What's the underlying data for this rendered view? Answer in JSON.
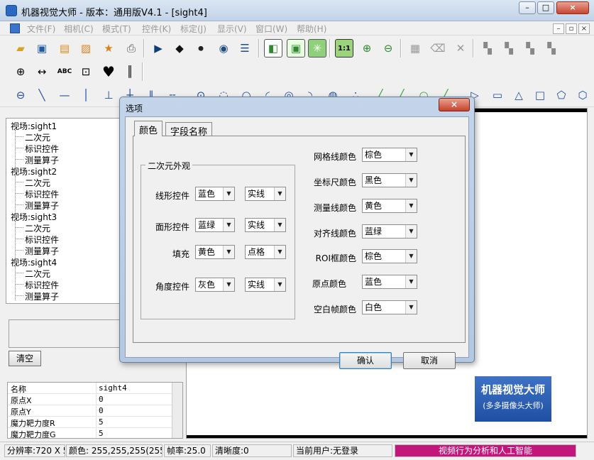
{
  "window": {
    "title": "机器视觉大师 - 版本：通用版V4.1 - [sight4]",
    "minimize": "–",
    "maximize": "□",
    "close": "×"
  },
  "menu": {
    "items": [
      "文件(F)",
      "相机(C)",
      "模式(T)",
      "控件(K)",
      "标定(J)",
      "显示(V)",
      "窗口(W)",
      "帮助(H)"
    ],
    "mdi": [
      "–",
      "▫",
      "×"
    ]
  },
  "toolbar1": {
    "icons": [
      "open-folder-icon",
      "save-icon",
      "open-file-icon",
      "image-icon",
      "import-icon",
      "print-icon",
      "play-icon",
      "step-icon",
      "stop-icon",
      "camera-settings-icon",
      "list-icon",
      "frame-icon",
      "frame-fill-icon",
      "fit-icon",
      "actual-size-icon",
      "zoom-in-icon",
      "zoom-out-icon",
      "picture-disabled-icon",
      "clear-disabled-icon",
      "delete-disabled-icon",
      "group-icon-1",
      "group-icon-2",
      "group-icon-3",
      "group-icon-4"
    ],
    "actual_size_label": "1:1"
  },
  "toolbar2": {
    "icons": [
      "crosshair-icon",
      "arrows-icon",
      "abc-icon",
      "text-box-icon",
      "heart-icon",
      "barcode-icon"
    ],
    "abc_label": "ABC"
  },
  "tree": {
    "nodes": [
      {
        "label": "视场:sight1",
        "children": [
          "二次元",
          "标识控件",
          "测量算子"
        ]
      },
      {
        "label": "视场:sight2",
        "children": [
          "二次元",
          "标识控件",
          "测量算子"
        ]
      },
      {
        "label": "视场:sight3",
        "children": [
          "二次元",
          "标识控件",
          "测量算子"
        ]
      },
      {
        "label": "视场:sight4",
        "children": [
          "二次元",
          "标识控件",
          "测量算子"
        ]
      }
    ]
  },
  "log": {
    "clear_label": "清空"
  },
  "properties": [
    {
      "key": "名称",
      "value": "sight4"
    },
    {
      "key": "原点X",
      "value": "0"
    },
    {
      "key": "原点Y",
      "value": "0"
    },
    {
      "key": "魔力靶力度R",
      "value": "5"
    },
    {
      "key": "魔力靶力度G",
      "value": "5"
    }
  ],
  "promo": {
    "line1": "机器视觉大师",
    "line2": "(多多摄像头大师)"
  },
  "status": {
    "resolution": "分辨率:720 X 5",
    "color": "颜色: 255,255,255(255)",
    "fps": "帧率:25.0",
    "sharpness": "清晰度:0",
    "user": "当前用户:无登录",
    "slogan": "视频行为分析和人工智能"
  },
  "dialog": {
    "title": "选项",
    "close_label": "×",
    "tabs": [
      "颜色",
      "字段名称"
    ],
    "group_title": "二次元外观",
    "left_fields": [
      {
        "label": "线形控件",
        "color": "蓝色",
        "style": "实线"
      },
      {
        "label": "面形控件",
        "color": "蓝绿",
        "style": "实线"
      },
      {
        "label": "填充",
        "color": "黄色",
        "style": "点格"
      },
      {
        "label": "角度控件",
        "color": "灰色",
        "style": "实线"
      }
    ],
    "right_fields": [
      {
        "label": "网格线颜色",
        "value": "棕色"
      },
      {
        "label": "坐标尺颜色",
        "value": "黑色"
      },
      {
        "label": "测量线颜色",
        "value": "黄色"
      },
      {
        "label": "对齐线颜色",
        "value": "蓝绿"
      },
      {
        "label": "ROI框颜色",
        "value": "棕色"
      },
      {
        "label": "原点颜色",
        "value": "蓝色"
      },
      {
        "label": "空白帧颜色",
        "value": "白色"
      }
    ],
    "ok_label": "确认",
    "cancel_label": "取消"
  }
}
